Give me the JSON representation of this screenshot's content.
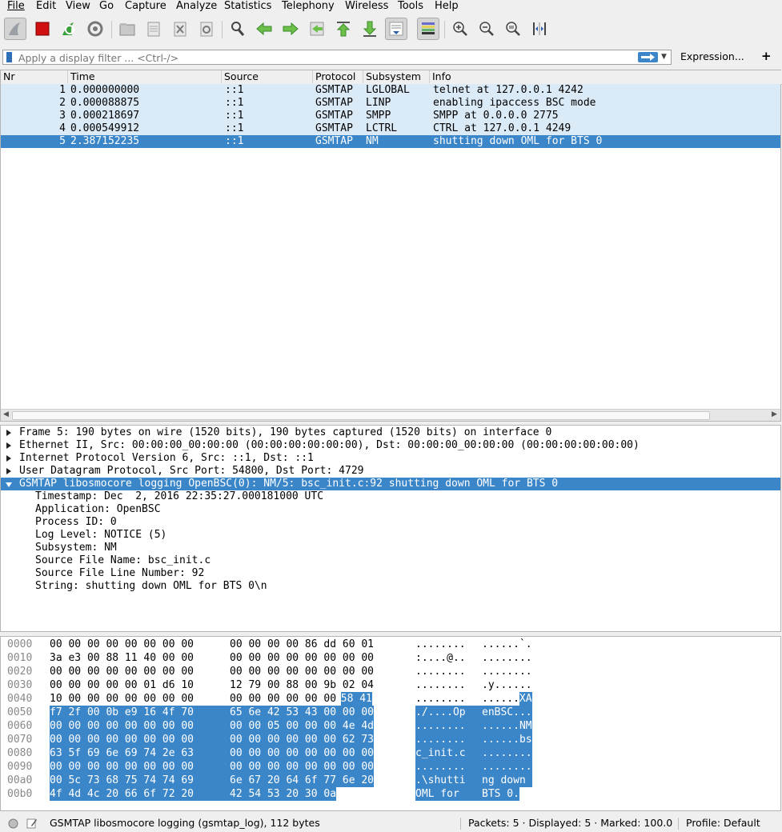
{
  "menu": [
    "File",
    "Edit",
    "View",
    "Go",
    "Capture",
    "Analyze",
    "Statistics",
    "Telephony",
    "Wireless",
    "Tools",
    "Help"
  ],
  "toolbar": {
    "buttons": [
      "shark-fin-icon",
      "stop-icon",
      "restart-icon",
      "options-icon",
      "open-icon",
      "save-icon",
      "close-file-icon",
      "reload-icon",
      "find-icon",
      "back-icon",
      "forward-icon",
      "goto-icon",
      "first-icon",
      "last-icon",
      "autoscroll-icon",
      "colorize-icon",
      "zoom-in-icon",
      "zoom-out-icon",
      "zoom-normal-icon",
      "resize-columns-icon"
    ]
  },
  "filter": {
    "placeholder": "Apply a display filter ... <Ctrl-/>",
    "expression_label": "Expression...",
    "plus_label": "+"
  },
  "packet_list": {
    "columns": [
      "Nr",
      "Time",
      "Source",
      "Protocol",
      "Subsystem",
      "Info"
    ],
    "rows": [
      {
        "nr": "1",
        "time": "0.000000000",
        "source": "::1",
        "protocol": "GSMTAP",
        "subsystem": "LGLOBAL",
        "info": "telnet at 127.0.0.1 4242"
      },
      {
        "nr": "2",
        "time": "0.000088875",
        "source": "::1",
        "protocol": "GSMTAP",
        "subsystem": "LINP",
        "info": "enabling ipaccess BSC mode"
      },
      {
        "nr": "3",
        "time": "0.000218697",
        "source": "::1",
        "protocol": "GSMTAP",
        "subsystem": "SMPP",
        "info": "SMPP at 0.0.0.0 2775"
      },
      {
        "nr": "4",
        "time": "0.000549912",
        "source": "::1",
        "protocol": "GSMTAP",
        "subsystem": "LCTRL",
        "info": "CTRL at 127.0.0.1 4249"
      },
      {
        "nr": "5",
        "time": "2.387152235",
        "source": "::1",
        "protocol": "GSMTAP",
        "subsystem": "NM",
        "info": "shutting down OML for BTS 0"
      }
    ]
  },
  "details": {
    "frame": "Frame 5: 190 bytes on wire (1520 bits), 190 bytes captured (1520 bits) on interface 0",
    "ethernet": "Ethernet II, Src: 00:00:00_00:00:00 (00:00:00:00:00:00), Dst: 00:00:00_00:00:00 (00:00:00:00:00:00)",
    "ipv6": "Internet Protocol Version 6, Src: ::1, Dst: ::1",
    "udp": "User Datagram Protocol, Src Port: 54800, Dst Port: 4729",
    "gsmtap": "GSMTAP libosmocore logging OpenBSC(0): NM/5: bsc_init.c:92 shutting down OML for BTS 0",
    "fields": [
      "Timestamp: Dec  2, 2016 22:35:27.000181000 UTC",
      "Application: OpenBSC",
      "Process ID: 0",
      "Log Level: NOTICE (5)",
      "Subsystem: NM",
      "Source File Name: bsc_init.c",
      "Source File Line Number: 92",
      "String: shutting down OML for BTS 0\\n"
    ]
  },
  "bytes": {
    "rows": [
      {
        "off": "0000",
        "hex1": "00 00 00 00 00 00 00 00",
        "hex2": "00 00 00 00 86 dd 60 01",
        "asc1": "........",
        "asc2": "......`."
      },
      {
        "off": "0010",
        "hex1": "3a e3 00 88 11 40 00 00",
        "hex2": "00 00 00 00 00 00 00 00",
        "asc1": ":....@..",
        "asc2": "........"
      },
      {
        "off": "0020",
        "hex1": "00 00 00 00 00 00 00 00",
        "hex2": "00 00 00 00 00 00 00 00",
        "asc1": "........",
        "asc2": "........"
      },
      {
        "off": "0030",
        "hex1": "00 00 00 00 00 01 d6 10",
        "hex2": "12 79 00 88 00 9b 02 04",
        "asc1": "........",
        "asc2": ".y......"
      },
      {
        "off": "0040",
        "hex1": "10 00 00 00 00 00 00 00",
        "hex2": "00 00 00 00 00 00",
        "hex2hl": "58 41",
        "asc1": "........",
        "asc2": "......",
        "asc2hl": "XA"
      },
      {
        "off": "0050",
        "hex1hl": "f7 2f 00 0b e9 16 4f 70",
        "hex2hl": "65 6e 42 53 43 00 00 00",
        "asc1hl": "./....Op",
        "asc2hl": "enBSC..."
      },
      {
        "off": "0060",
        "hex1hl": "00 00 00 00 00 00 00 00",
        "hex2hl": "00 00 05 00 00 00 4e 4d",
        "asc1hl": "........",
        "asc2hl": "......NM"
      },
      {
        "off": "0070",
        "hex1hl": "00 00 00 00 00 00 00 00",
        "hex2hl": "00 00 00 00 00 00 62 73",
        "asc1hl": "........",
        "asc2hl": "......bs"
      },
      {
        "off": "0080",
        "hex1hl": "63 5f 69 6e 69 74 2e 63",
        "hex2hl": "00 00 00 00 00 00 00 00",
        "asc1hl": "c_init.c",
        "asc2hl": "........"
      },
      {
        "off": "0090",
        "hex1hl": "00 00 00 00 00 00 00 00",
        "hex2hl": "00 00 00 00 00 00 00 00",
        "asc1hl": "........",
        "asc2hl": "........"
      },
      {
        "off": "00a0",
        "hex1hl": "00 5c 73 68 75 74 74 69",
        "hex2hl": "6e 67 20 64 6f 77 6e 20",
        "asc1hl": ".\\shutti",
        "asc2hl": "ng down "
      },
      {
        "off": "00b0",
        "hex1hl": "4f 4d 4c 20 66 6f 72 20",
        "hex2hl": "42 54 53 20 30 0a",
        "asc1hl": "OML for ",
        "asc2hl": "BTS 0."
      }
    ]
  },
  "status": {
    "field": "GSMTAP libosmocore logging (gsmtap_log), 112 bytes",
    "counts": "Packets: 5 · Displayed: 5 · Marked: 100.0",
    "profile": "Profile: Default"
  },
  "colors": {
    "selection": "#3b86c8",
    "row_bg": "#dbeaf7"
  }
}
